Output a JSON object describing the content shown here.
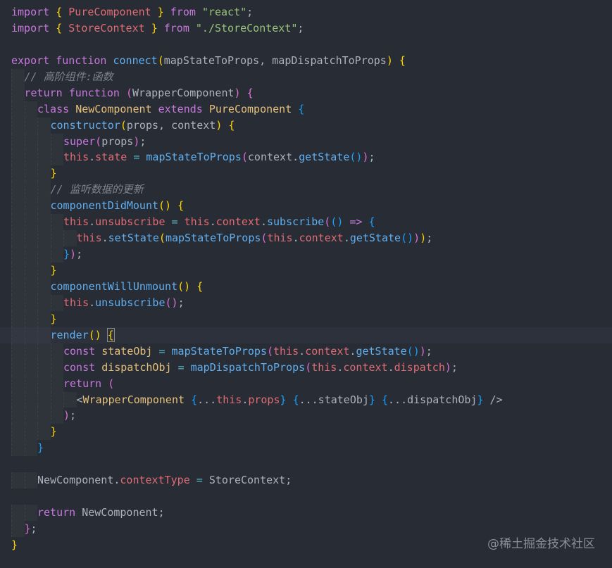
{
  "editor": {
    "watermark": "@稀土掘金技术社区",
    "current_line": 20,
    "lines": [
      {
        "indent": 0,
        "tokens": [
          [
            "kw",
            "import"
          ],
          [
            "var",
            " "
          ],
          [
            "b1",
            "{"
          ],
          [
            "var",
            " "
          ],
          [
            "prop",
            "PureComponent"
          ],
          [
            "var",
            " "
          ],
          [
            "b1",
            "}"
          ],
          [
            "var",
            " "
          ],
          [
            "kw",
            "from"
          ],
          [
            "var",
            " "
          ],
          [
            "str",
            "\"react\""
          ],
          [
            "var",
            ";"
          ]
        ]
      },
      {
        "indent": 0,
        "tokens": [
          [
            "kw",
            "import"
          ],
          [
            "var",
            " "
          ],
          [
            "b1",
            "{"
          ],
          [
            "var",
            " "
          ],
          [
            "prop",
            "StoreContext"
          ],
          [
            "var",
            " "
          ],
          [
            "b1",
            "}"
          ],
          [
            "var",
            " "
          ],
          [
            "kw",
            "from"
          ],
          [
            "var",
            " "
          ],
          [
            "str",
            "\"./StoreContext\""
          ],
          [
            "var",
            ";"
          ]
        ]
      },
      {
        "indent": 0,
        "tokens": []
      },
      {
        "indent": 0,
        "tokens": [
          [
            "kw",
            "export"
          ],
          [
            "var",
            " "
          ],
          [
            "kw",
            "function"
          ],
          [
            "var",
            " "
          ],
          [
            "fn",
            "connect"
          ],
          [
            "b1",
            "("
          ],
          [
            "var",
            "mapStateToProps, mapDispatchToProps"
          ],
          [
            "b1",
            ")"
          ],
          [
            "var",
            " "
          ],
          [
            "b1",
            "{"
          ]
        ]
      },
      {
        "indent": 1,
        "tokens": [
          [
            "cmt",
            "// 高阶组件:函数"
          ]
        ]
      },
      {
        "indent": 1,
        "tokens": [
          [
            "kw",
            "return"
          ],
          [
            "var",
            " "
          ],
          [
            "kw",
            "function"
          ],
          [
            "var",
            " "
          ],
          [
            "b2",
            "("
          ],
          [
            "var",
            "WrapperComponent"
          ],
          [
            "b2",
            ")"
          ],
          [
            "var",
            " "
          ],
          [
            "b2",
            "{"
          ]
        ]
      },
      {
        "indent": 2,
        "tokens": [
          [
            "kw",
            "class"
          ],
          [
            "var",
            " "
          ],
          [
            "cls",
            "NewComponent"
          ],
          [
            "var",
            " "
          ],
          [
            "kw",
            "extends"
          ],
          [
            "var",
            " "
          ],
          [
            "cls",
            "PureComponent"
          ],
          [
            "var",
            " "
          ],
          [
            "b3",
            "{"
          ]
        ]
      },
      {
        "indent": 3,
        "tokens": [
          [
            "fn",
            "constructor"
          ],
          [
            "b1",
            "("
          ],
          [
            "var",
            "props, context"
          ],
          [
            "b1",
            ")"
          ],
          [
            "var",
            " "
          ],
          [
            "b1",
            "{"
          ]
        ]
      },
      {
        "indent": 4,
        "tokens": [
          [
            "kw",
            "super"
          ],
          [
            "b2",
            "("
          ],
          [
            "var",
            "props"
          ],
          [
            "b2",
            ")"
          ],
          [
            "var",
            ";"
          ]
        ]
      },
      {
        "indent": 4,
        "tokens": [
          [
            "prop",
            "this"
          ],
          [
            "var",
            "."
          ],
          [
            "prop",
            "state"
          ],
          [
            "var",
            " "
          ],
          [
            "op",
            "="
          ],
          [
            "var",
            " "
          ],
          [
            "fn",
            "mapStateToProps"
          ],
          [
            "b2",
            "("
          ],
          [
            "var",
            "context."
          ],
          [
            "fn",
            "getState"
          ],
          [
            "b3",
            "()"
          ],
          [
            "b2",
            ")"
          ],
          [
            "var",
            ";"
          ]
        ]
      },
      {
        "indent": 3,
        "tokens": [
          [
            "b1",
            "}"
          ]
        ]
      },
      {
        "indent": 3,
        "tokens": [
          [
            "cmt",
            "// 监听数据的更新"
          ]
        ]
      },
      {
        "indent": 3,
        "tokens": [
          [
            "fn",
            "componentDidMount"
          ],
          [
            "b1",
            "()"
          ],
          [
            "var",
            " "
          ],
          [
            "b1",
            "{"
          ]
        ]
      },
      {
        "indent": 4,
        "tokens": [
          [
            "prop",
            "this"
          ],
          [
            "var",
            "."
          ],
          [
            "prop",
            "unsubscribe"
          ],
          [
            "var",
            " "
          ],
          [
            "op",
            "="
          ],
          [
            "var",
            " "
          ],
          [
            "prop",
            "this"
          ],
          [
            "var",
            "."
          ],
          [
            "prop",
            "context"
          ],
          [
            "var",
            "."
          ],
          [
            "fn",
            "subscribe"
          ],
          [
            "b2",
            "("
          ],
          [
            "b3",
            "()"
          ],
          [
            "var",
            " "
          ],
          [
            "kw",
            "=>"
          ],
          [
            "var",
            " "
          ],
          [
            "b3",
            "{"
          ]
        ]
      },
      {
        "indent": 5,
        "tokens": [
          [
            "prop",
            "this"
          ],
          [
            "var",
            "."
          ],
          [
            "fn",
            "setState"
          ],
          [
            "b1",
            "("
          ],
          [
            "fn",
            "mapStateToProps"
          ],
          [
            "b2",
            "("
          ],
          [
            "prop",
            "this"
          ],
          [
            "var",
            "."
          ],
          [
            "prop",
            "context"
          ],
          [
            "var",
            "."
          ],
          [
            "fn",
            "getState"
          ],
          [
            "b3",
            "()"
          ],
          [
            "b2",
            ")"
          ],
          [
            "b1",
            ")"
          ],
          [
            "var",
            ";"
          ]
        ]
      },
      {
        "indent": 4,
        "tokens": [
          [
            "b3",
            "}"
          ],
          [
            "b2",
            ")"
          ],
          [
            "var",
            ";"
          ]
        ]
      },
      {
        "indent": 3,
        "tokens": [
          [
            "b1",
            "}"
          ]
        ]
      },
      {
        "indent": 3,
        "tokens": [
          [
            "fn",
            "componentWillUnmount"
          ],
          [
            "b1",
            "()"
          ],
          [
            "var",
            " "
          ],
          [
            "b1",
            "{"
          ]
        ]
      },
      {
        "indent": 4,
        "tokens": [
          [
            "prop",
            "this"
          ],
          [
            "var",
            "."
          ],
          [
            "fn",
            "unsubscribe"
          ],
          [
            "b2",
            "()"
          ],
          [
            "var",
            ";"
          ]
        ]
      },
      {
        "indent": 3,
        "tokens": [
          [
            "b1",
            "}"
          ]
        ]
      },
      {
        "indent": 3,
        "tokens": [
          [
            "fn",
            "render"
          ],
          [
            "b1",
            "()"
          ],
          [
            "var",
            " "
          ],
          [
            "b1",
            "{"
          ]
        ]
      },
      {
        "indent": 4,
        "tokens": [
          [
            "kw",
            "const"
          ],
          [
            "var",
            " "
          ],
          [
            "cls",
            "stateObj"
          ],
          [
            "var",
            " "
          ],
          [
            "op",
            "="
          ],
          [
            "var",
            " "
          ],
          [
            "fn",
            "mapStateToProps"
          ],
          [
            "b2",
            "("
          ],
          [
            "prop",
            "this"
          ],
          [
            "var",
            "."
          ],
          [
            "prop",
            "context"
          ],
          [
            "var",
            "."
          ],
          [
            "fn",
            "getState"
          ],
          [
            "b3",
            "()"
          ],
          [
            "b2",
            ")"
          ],
          [
            "var",
            ";"
          ]
        ]
      },
      {
        "indent": 4,
        "tokens": [
          [
            "kw",
            "const"
          ],
          [
            "var",
            " "
          ],
          [
            "cls",
            "dispatchObj"
          ],
          [
            "var",
            " "
          ],
          [
            "op",
            "="
          ],
          [
            "var",
            " "
          ],
          [
            "fn",
            "mapDispatchToProps"
          ],
          [
            "b2",
            "("
          ],
          [
            "prop",
            "this"
          ],
          [
            "var",
            "."
          ],
          [
            "prop",
            "context"
          ],
          [
            "var",
            "."
          ],
          [
            "prop",
            "dispatch"
          ],
          [
            "b2",
            ")"
          ],
          [
            "var",
            ";"
          ]
        ]
      },
      {
        "indent": 4,
        "tokens": [
          [
            "kw",
            "return"
          ],
          [
            "var",
            " "
          ],
          [
            "b2",
            "("
          ]
        ]
      },
      {
        "indent": 5,
        "tokens": [
          [
            "var",
            "<"
          ],
          [
            "cls",
            "WrapperComponent"
          ],
          [
            "var",
            " "
          ],
          [
            "b3",
            "{"
          ],
          [
            "var",
            "..."
          ],
          [
            "prop",
            "this"
          ],
          [
            "var",
            "."
          ],
          [
            "prop",
            "props"
          ],
          [
            "b3",
            "}"
          ],
          [
            "var",
            " "
          ],
          [
            "b3",
            "{"
          ],
          [
            "var",
            "...stateObj"
          ],
          [
            "b3",
            "}"
          ],
          [
            "var",
            " "
          ],
          [
            "b3",
            "{"
          ],
          [
            "var",
            "...dispatchObj"
          ],
          [
            "b3",
            "}"
          ],
          [
            "var",
            " />"
          ]
        ]
      },
      {
        "indent": 4,
        "tokens": [
          [
            "b2",
            ")"
          ],
          [
            "var",
            ";"
          ]
        ]
      },
      {
        "indent": 3,
        "tokens": [
          [
            "b1",
            "}"
          ]
        ]
      },
      {
        "indent": 2,
        "tokens": [
          [
            "b3",
            "}"
          ]
        ]
      },
      {
        "indent": 0,
        "tokens": []
      },
      {
        "indent": 2,
        "tokens": [
          [
            "var",
            "NewComponent."
          ],
          [
            "prop",
            "contextType"
          ],
          [
            "var",
            " "
          ],
          [
            "op",
            "="
          ],
          [
            "var",
            " StoreContext;"
          ]
        ]
      },
      {
        "indent": 0,
        "tokens": []
      },
      {
        "indent": 2,
        "tokens": [
          [
            "kw",
            "return"
          ],
          [
            "var",
            " NewComponent;"
          ]
        ]
      },
      {
        "indent": 1,
        "tokens": [
          [
            "b2",
            "}"
          ],
          [
            "var",
            ";"
          ]
        ]
      },
      {
        "indent": 0,
        "tokens": [
          [
            "b1",
            "}"
          ]
        ]
      }
    ]
  }
}
